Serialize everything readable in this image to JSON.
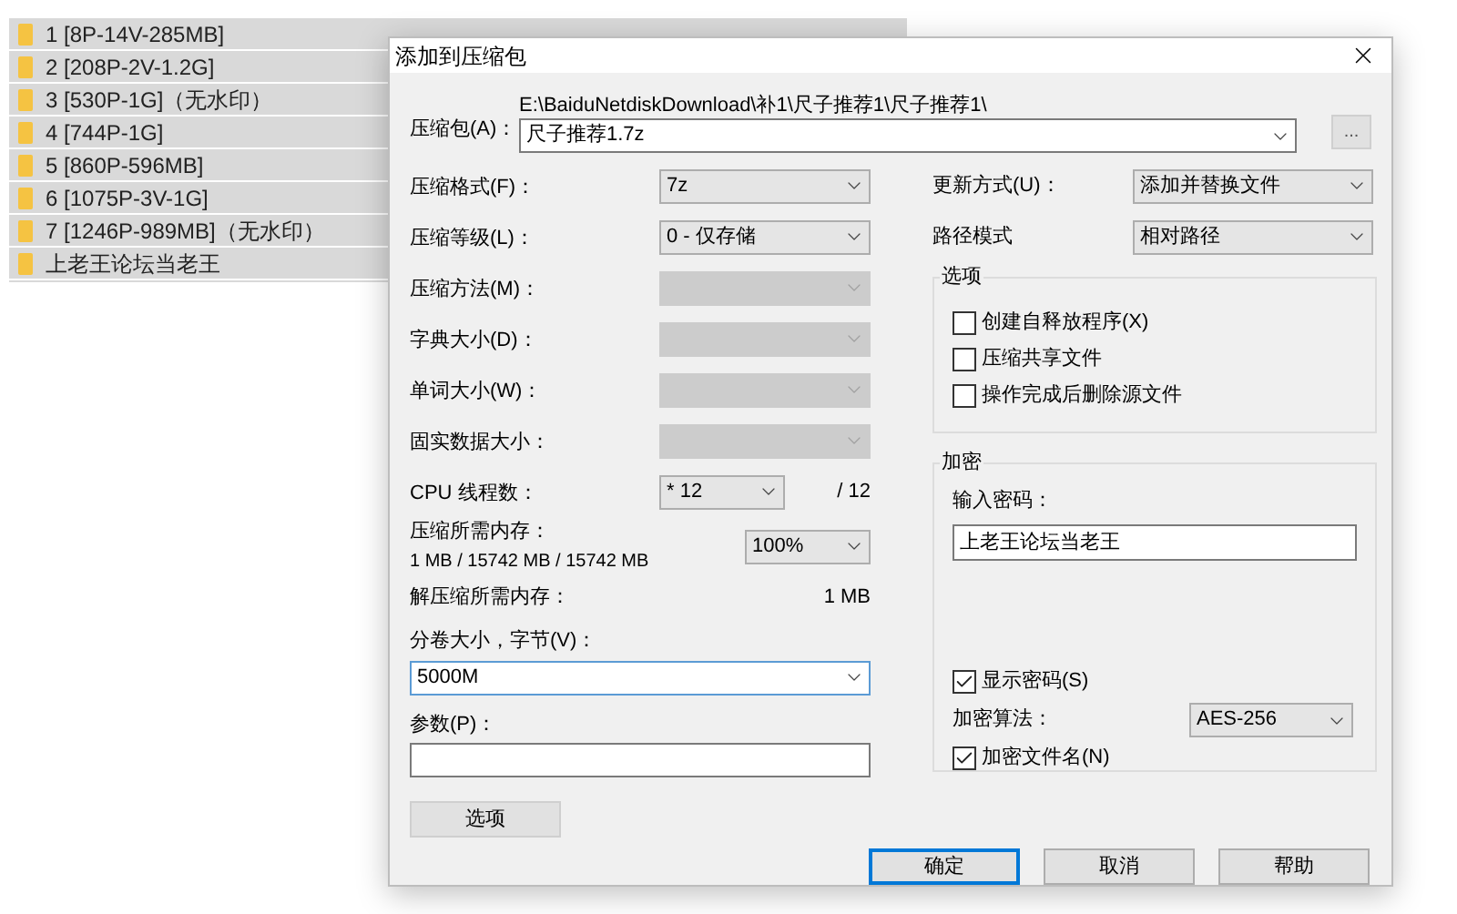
{
  "file_list": {
    "rows": [
      {
        "name": "1 [8P-14V-285MB]"
      },
      {
        "name": "2 [208P-2V-1.2G]"
      },
      {
        "name": "3 [530P-1G]（无水印）"
      },
      {
        "name": "4 [744P-1G]"
      },
      {
        "name": "5 [860P-596MB]"
      },
      {
        "name": "6 [1075P-3V-1G]"
      },
      {
        "name": "7 [1246P-989MB]（无水印）"
      },
      {
        "name": "上老王论坛当老王"
      }
    ]
  },
  "dialog": {
    "title": "添加到压缩包",
    "archive": {
      "label": "压缩包(A)：",
      "path": "E:\\BaiduNetdiskDownload\\补1\\尺子推荐1\\尺子推荐1\\",
      "value": "尺子推荐1.7z",
      "browse": "..."
    },
    "left_fields": [
      {
        "kind": "combo",
        "label": "压缩格式(F)：",
        "value": "7z",
        "disabled": false
      },
      {
        "kind": "combo",
        "label": "压缩等级(L)：",
        "value": "0 - 仅存储",
        "disabled": false
      },
      {
        "kind": "combo",
        "label": "压缩方法(M)：",
        "disabled": true
      },
      {
        "kind": "combo",
        "label": "字典大小(D)：",
        "disabled": true
      },
      {
        "kind": "combo",
        "label": "单词大小(W)：",
        "disabled": true
      },
      {
        "kind": "combo",
        "label": "固实数据大小：",
        "disabled": true
      },
      {
        "kind": "cpu",
        "label": "CPU 线程数：",
        "value": "* 12",
        "total": "/ 12"
      },
      {
        "kind": "memory",
        "label": "压缩所需内存：",
        "detail": "1 MB / 15742 MB / 15742 MB",
        "value": "100%"
      },
      {
        "kind": "info",
        "label": "解压缩所需内存：",
        "value": "1 MB"
      }
    ],
    "volume": {
      "label": "分卷大小，字节(V)：",
      "value": "5000M"
    },
    "params": {
      "label": "参数(P)："
    },
    "options_button": "选项",
    "right_fields": [
      {
        "label": "更新方式(U)：",
        "value": "添加并替换文件"
      },
      {
        "label": "路径模式",
        "value": "相对路径"
      }
    ],
    "options": {
      "title": "选项",
      "items": [
        {
          "label": "创建自释放程序(X)",
          "checked": false
        },
        {
          "label": "压缩共享文件",
          "checked": false
        },
        {
          "label": "操作完成后删除源文件",
          "checked": false
        }
      ]
    },
    "encryption": {
      "title": "加密",
      "password_label": "输入密码：",
      "password": "上老王论坛当老王",
      "show_password": {
        "label": "显示密码(S)",
        "checked": true
      },
      "method_label": "加密算法：",
      "method": "AES-256",
      "encrypt_names": {
        "label": "加密文件名(N)",
        "checked": true
      }
    },
    "buttons": [
      {
        "label": "确定",
        "default": true
      },
      {
        "label": "取消",
        "default": false
      },
      {
        "label": "帮助",
        "default": false
      }
    ]
  }
}
